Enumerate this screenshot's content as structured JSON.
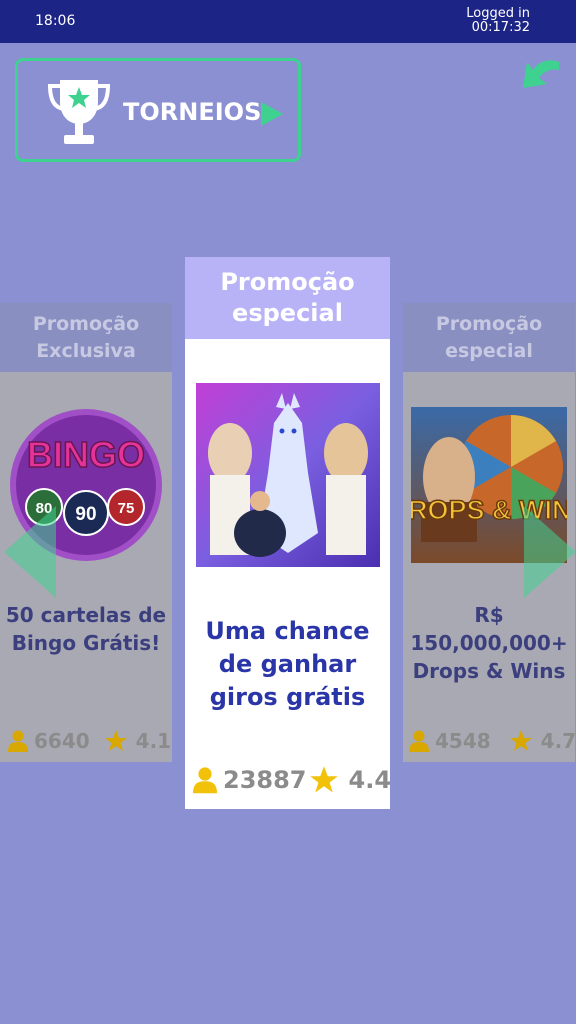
{
  "status_bar": {
    "time": "18:06",
    "login_line1": "Logged in",
    "login_line2": "00:17:32"
  },
  "torneios": {
    "label": "TORNEIOS"
  },
  "cards": {
    "left": {
      "header": "Promoção Exclusiva",
      "title": "50 cartelas de Bingo Grátis!",
      "players": "6640",
      "rating": "4.1",
      "ball_labels": [
        "BINGO",
        "80",
        "90",
        "75"
      ]
    },
    "center": {
      "header": "Promoção especial",
      "title": "Uma chance de ganhar giros grátis",
      "players": "23887",
      "rating": "4.4"
    },
    "right": {
      "header": "Promoção especial",
      "title": "R$ 150,000,000+ Drops & Wins",
      "players": "4548",
      "rating": "4.7",
      "logo_text": "DROPS & WINS"
    }
  },
  "colors": {
    "background": "#8b90d2",
    "status_bar": "#1c2486",
    "accent_green": "#3fd18f",
    "title_blue": "#2a36a8",
    "star": "#f2c20a"
  }
}
